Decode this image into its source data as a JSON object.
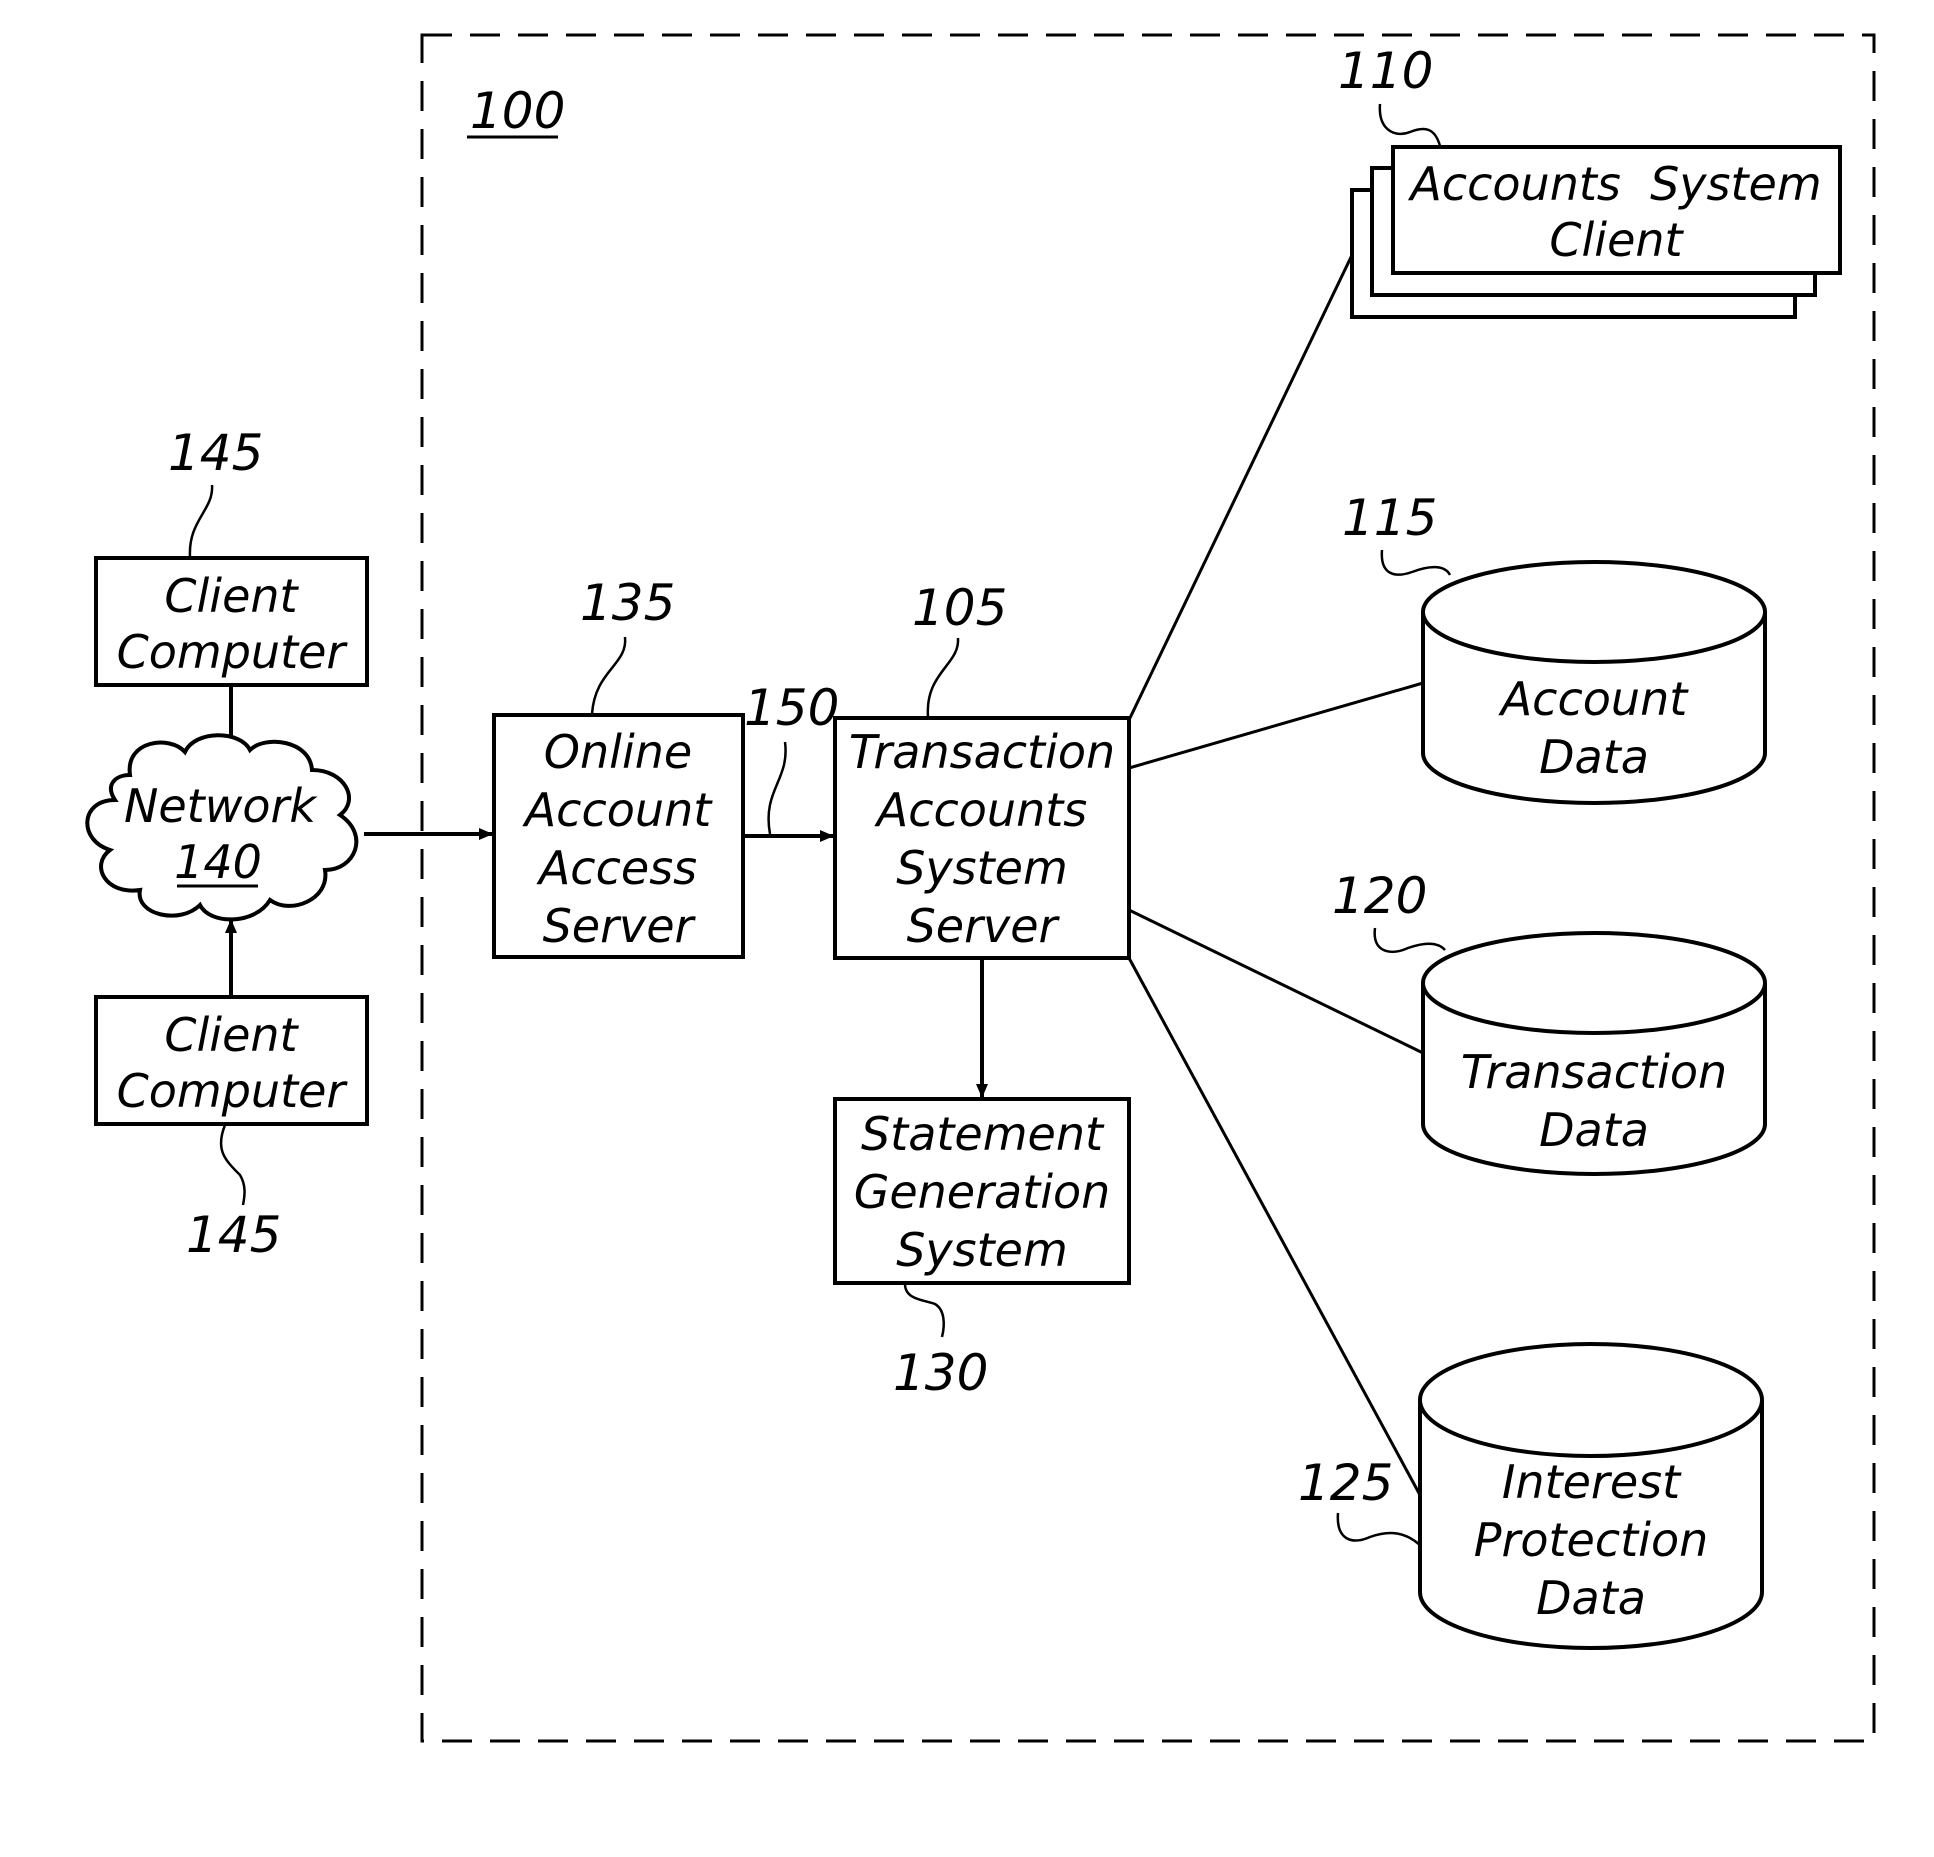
{
  "figure": {
    "system_ref": "100",
    "nodes": {
      "client_top": {
        "lines": [
          "Client",
          "Computer"
        ],
        "ref": "145"
      },
      "client_bottom": {
        "lines": [
          "Client",
          "Computer"
        ],
        "ref": "145"
      },
      "network": {
        "name": "Network",
        "ref": "140"
      },
      "oaas": {
        "lines": [
          "Online",
          "Account",
          "Access",
          "Server"
        ],
        "ref": "135"
      },
      "tass": {
        "lines": [
          "Transaction",
          "Accounts",
          "System",
          "Server"
        ],
        "ref": "105"
      },
      "sgs": {
        "lines": [
          "Statement",
          "Generation",
          "System"
        ],
        "ref": "130"
      },
      "asc": {
        "lines": [
          "Accounts  System",
          "Client"
        ],
        "ref": "110"
      },
      "account_data": {
        "lines": [
          "Account",
          "Data"
        ],
        "ref": "115"
      },
      "transaction_data": {
        "lines": [
          "Transaction",
          "Data"
        ],
        "ref": "120"
      },
      "interest_data": {
        "lines": [
          "Interest",
          "Protection",
          "Data"
        ],
        "ref": "125"
      }
    },
    "connection_ref": "150",
    "edges": [
      {
        "from": "client_top",
        "to": "network",
        "arrow": true
      },
      {
        "from": "client_bottom",
        "to": "network",
        "arrow": true
      },
      {
        "from": "network",
        "to": "oaas",
        "arrow": true
      },
      {
        "from": "oaas",
        "to": "tass",
        "arrow": true
      },
      {
        "from": "tass",
        "to": "sgs",
        "arrow": true
      },
      {
        "from": "tass",
        "to": "asc",
        "arrow": false
      },
      {
        "from": "tass",
        "to": "account_data",
        "arrow": false
      },
      {
        "from": "tass",
        "to": "transaction_data",
        "arrow": false
      },
      {
        "from": "tass",
        "to": "interest_data",
        "arrow": false
      }
    ]
  }
}
